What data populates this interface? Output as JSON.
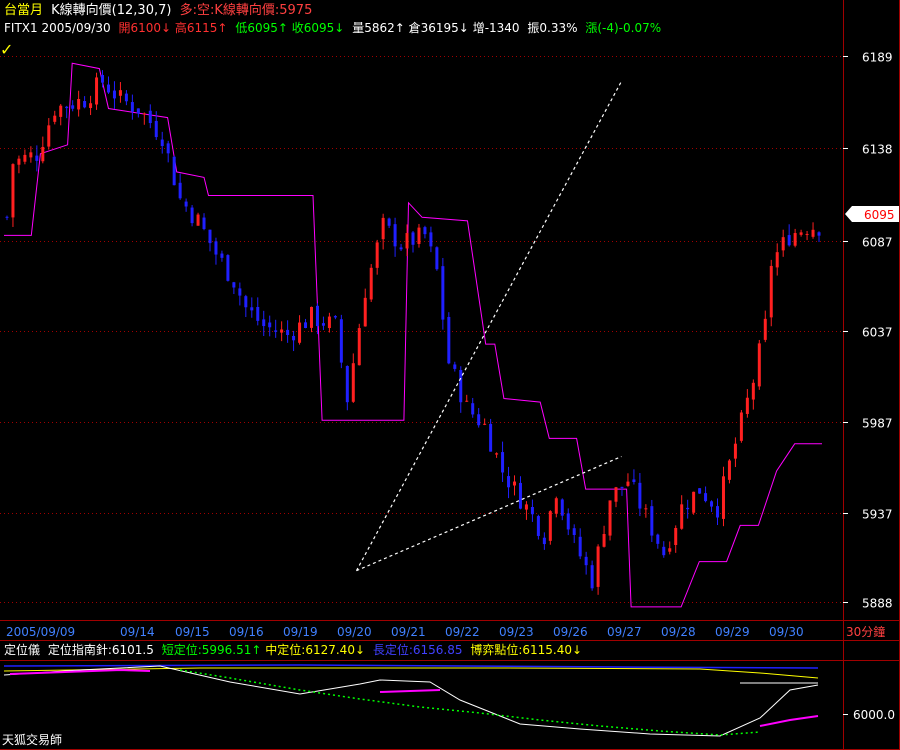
{
  "header": {
    "title": "台當月",
    "indicator_name": "K線轉向價(12,30,7)",
    "indicator_value": "多:空:K線轉向價:5975",
    "symbol_date": "FITX1 2005/09/30",
    "open": "開6100↓",
    "high": "高6115↑",
    "low": "低6095↑",
    "close": "收6095↓",
    "volume": "量5862↑",
    "oi": "倉36195↓",
    "change_oi": "增-1340",
    "amplitude": "振0.33%",
    "change": "漲(-4)-0.07%"
  },
  "price_axis": {
    "ticks": [
      "6189",
      "6138",
      "6087",
      "6037",
      "5987",
      "5937",
      "5888"
    ],
    "current_tag": "6095"
  },
  "time_axis": {
    "labels": [
      "2005/09/09",
      "09/14",
      "09/15",
      "09/16",
      "09/19",
      "09/20",
      "09/21",
      "09/22",
      "09/23",
      "09/26",
      "09/27",
      "09/28",
      "09/29",
      "09/30"
    ],
    "period": "30分鐘"
  },
  "sub_panel": {
    "name": "定位儀",
    "pointer": "定位指南針:6101.5",
    "short": "短定位:5996.51↑",
    "mid": "中定位:6127.40↓",
    "long": "長定位:6156.85",
    "game": "博弈點位:6115.40↓",
    "axis_tick": "6000.0"
  },
  "footer": {
    "brand": "天狐交易師"
  },
  "colors": {
    "up": "#ff2020",
    "down": "#2020ff",
    "magenta": "#ff00ff",
    "grid": "#a00000",
    "yellow": "#ffff00",
    "green": "#00ff00",
    "white": "#ffffff"
  },
  "chart_data": {
    "type": "candlestick",
    "y_range": [
      5880,
      6200
    ],
    "candle_count": 137,
    "anchors": [
      {
        "i": 0,
        "v": 6100
      },
      {
        "i": 1,
        "v": 6130
      },
      {
        "i": 5,
        "v": 6135
      },
      {
        "i": 8,
        "v": 6160
      },
      {
        "i": 13,
        "v": 6165
      },
      {
        "i": 16,
        "v": 6175
      },
      {
        "i": 19,
        "v": 6165
      },
      {
        "i": 22,
        "v": 6160
      },
      {
        "i": 26,
        "v": 6145
      },
      {
        "i": 29,
        "v": 6110
      },
      {
        "i": 32,
        "v": 6098
      },
      {
        "i": 35,
        "v": 6080
      },
      {
        "i": 38,
        "v": 6065
      },
      {
        "i": 40,
        "v": 6050
      },
      {
        "i": 43,
        "v": 6040
      },
      {
        "i": 47,
        "v": 6035
      },
      {
        "i": 51,
        "v": 6045
      },
      {
        "i": 55,
        "v": 6040
      },
      {
        "i": 57,
        "v": 6000
      },
      {
        "i": 60,
        "v": 6060
      },
      {
        "i": 63,
        "v": 6095
      },
      {
        "i": 66,
        "v": 6085
      },
      {
        "i": 70,
        "v": 6090
      },
      {
        "i": 72,
        "v": 6070
      },
      {
        "i": 74,
        "v": 6020
      },
      {
        "i": 77,
        "v": 5995
      },
      {
        "i": 80,
        "v": 5985
      },
      {
        "i": 83,
        "v": 5960
      },
      {
        "i": 86,
        "v": 5945
      },
      {
        "i": 90,
        "v": 5925
      },
      {
        "i": 92,
        "v": 5950
      },
      {
        "i": 95,
        "v": 5920
      },
      {
        "i": 98,
        "v": 5900
      },
      {
        "i": 101,
        "v": 5945
      },
      {
        "i": 104,
        "v": 5955
      },
      {
        "i": 107,
        "v": 5935
      },
      {
        "i": 110,
        "v": 5915
      },
      {
        "i": 113,
        "v": 5940
      },
      {
        "i": 116,
        "v": 5950
      },
      {
        "i": 119,
        "v": 5940
      },
      {
        "i": 122,
        "v": 5975
      },
      {
        "i": 125,
        "v": 6010
      },
      {
        "i": 127,
        "v": 6040
      },
      {
        "i": 128,
        "v": 6075
      },
      {
        "i": 131,
        "v": 6090
      },
      {
        "i": 134,
        "v": 6095
      },
      {
        "i": 136,
        "v": 6095
      }
    ],
    "turn_price_line": [
      {
        "i": 0,
        "v": 6090
      },
      {
        "i": 6,
        "v": 6090
      },
      {
        "i": 8,
        "v": 6135
      },
      {
        "i": 14,
        "v": 6140
      },
      {
        "i": 15,
        "v": 6185
      },
      {
        "i": 21,
        "v": 6182
      },
      {
        "i": 23,
        "v": 6160
      },
      {
        "i": 36,
        "v": 6155
      },
      {
        "i": 38,
        "v": 6125
      },
      {
        "i": 44,
        "v": 6122
      },
      {
        "i": 45,
        "v": 6112
      },
      {
        "i": 68,
        "v": 6112
      },
      {
        "i": 70,
        "v": 5988
      },
      {
        "i": 88,
        "v": 5988
      },
      {
        "i": 89,
        "v": 6108
      },
      {
        "i": 92,
        "v": 6100
      },
      {
        "i": 102,
        "v": 6098
      },
      {
        "i": 106,
        "v": 6030
      },
      {
        "i": 108,
        "v": 6030
      },
      {
        "i": 110,
        "v": 6000
      },
      {
        "i": 118,
        "v": 5998
      },
      {
        "i": 120,
        "v": 5978
      },
      {
        "i": 126,
        "v": 5978
      },
      {
        "i": 128,
        "v": 5950
      },
      {
        "i": 137,
        "v": 5950
      },
      {
        "i": 138,
        "v": 5885
      },
      {
        "i": 149,
        "v": 5885
      },
      {
        "i": 153,
        "v": 5910
      },
      {
        "i": 159,
        "v": 5910
      },
      {
        "i": 162,
        "v": 5930
      },
      {
        "i": 166,
        "v": 5930
      },
      {
        "i": 170,
        "v": 5960
      },
      {
        "i": 174,
        "v": 5975
      },
      {
        "i": 180,
        "v": 5975
      }
    ],
    "trend_lines": [
      {
        "from": [
          5.5,
          5905
        ],
        "to": [
          10.4,
          6175
        ]
      },
      {
        "from": [
          5.5,
          5905
        ],
        "to": [
          10.4,
          5968
        ]
      }
    ]
  }
}
